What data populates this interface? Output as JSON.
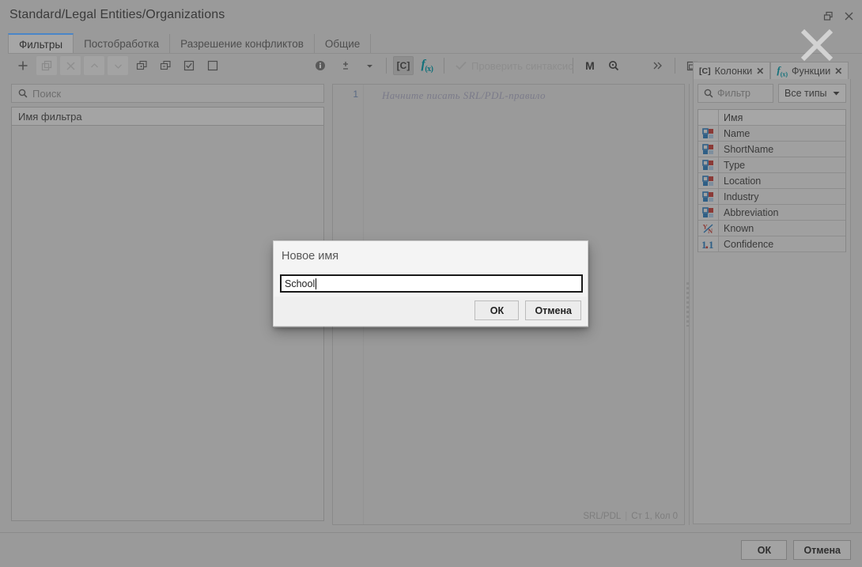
{
  "window": {
    "title": "Standard/Legal Entities/Organizations",
    "restore_icon": "restore-icon",
    "close_icon": "close-icon",
    "overlay_icon": "large-close-x-icon"
  },
  "tabs": [
    {
      "label": "Фильтры",
      "active": true
    },
    {
      "label": "Постобработка",
      "active": false
    },
    {
      "label": "Разрешение конфликтов",
      "active": false
    },
    {
      "label": "Общие",
      "active": false
    }
  ],
  "toolbar_left": [
    {
      "name": "add-filter-button",
      "icon": "plus-icon",
      "state": "enabled"
    },
    {
      "name": "duplicate-filter-button",
      "icon": "duplicate-icon",
      "state": "shaded"
    },
    {
      "name": "delete-filter-button",
      "icon": "close-x-icon",
      "state": "shaded"
    },
    {
      "name": "move-up-button",
      "icon": "chevron-up-icon",
      "state": "shaded"
    },
    {
      "name": "move-down-button",
      "icon": "chevron-down-icon",
      "state": "shaded"
    },
    {
      "name": "expand-all-button",
      "icon": "expand-box-plus-icon",
      "state": "enabled"
    },
    {
      "name": "collapse-all-button",
      "icon": "collapse-box-minus-icon",
      "state": "enabled"
    },
    {
      "name": "check-all-button",
      "icon": "checkbox-checked-icon",
      "state": "enabled"
    },
    {
      "name": "uncheck-all-button",
      "icon": "checkbox-empty-icon",
      "state": "enabled"
    }
  ],
  "toolbar_info": {
    "name": "info-button",
    "icon": "info-circle-icon"
  },
  "toolbar_middle": {
    "font_size_button": {
      "icon": "plus-minus-icon"
    },
    "font_size_dropdown": {
      "icon": "caret-down-icon"
    },
    "columns_toggle": {
      "label": "[C]",
      "icon": "columns-bracket-icon",
      "pressed": true
    },
    "functions_toggle": {
      "label": "f",
      "sub": "(x)",
      "icon": "function-fx-icon"
    },
    "check_syntax": {
      "label": "Проверить синтаксис",
      "icon": "checkmark-icon",
      "disabled": true
    },
    "markdown_button": {
      "label": "M",
      "icon": "markdown-m-icon"
    },
    "find_button": {
      "icon": "magnifier-icon"
    },
    "overflow_button": {
      "icon": "double-chevron-right-icon"
    },
    "panel_button": {
      "icon": "panel-layout-icon"
    }
  },
  "left_panel": {
    "search": {
      "placeholder": "Поиск",
      "value": "",
      "icon": "search-icon"
    },
    "column_header": "Имя фильтра",
    "rows": []
  },
  "editor": {
    "line_number": "1",
    "placeholder": "Начните писать SRL/PDL-правило",
    "status_language": "SRL/PDL",
    "status_separator": "|",
    "status_position": "Ст 1, Кол 0"
  },
  "splitter": {
    "name": "editor-panel-splitter"
  },
  "right_panel": {
    "tabs": [
      {
        "label": "Колонки",
        "icon": "columns-bracket-icon",
        "icon_text": "[C]",
        "close": "✕",
        "active": true
      },
      {
        "label": "Функции",
        "icon": "function-fx-icon",
        "icon_text": "f",
        "icon_sub": "(x)",
        "close": "✕",
        "active": false
      }
    ],
    "filter_input": {
      "placeholder": "Фильтр",
      "value": "",
      "icon": "search-icon"
    },
    "type_select": {
      "value": "Все типы",
      "icon": "caret-down-icon"
    },
    "table_header": "Имя",
    "columns": [
      {
        "name": "Name",
        "type": "string"
      },
      {
        "name": "ShortName",
        "type": "string"
      },
      {
        "name": "Type",
        "type": "string"
      },
      {
        "name": "Location",
        "type": "string"
      },
      {
        "name": "Industry",
        "type": "string"
      },
      {
        "name": "Abbreviation",
        "type": "string"
      },
      {
        "name": "Known",
        "type": "boolean"
      },
      {
        "name": "Confidence",
        "type": "number"
      }
    ]
  },
  "dialog": {
    "title": "Новое имя",
    "input_value": "School",
    "ok_label": "ОК",
    "cancel_label": "Отмена"
  },
  "footer": {
    "ok_label": "ОК",
    "cancel_label": "Отмена"
  },
  "colors": {
    "window_bg": "#9a9a9a",
    "accent_tab": "#4a86c8",
    "fx_teal": "#10707a",
    "icon_blue": "#2f5f86",
    "icon_red": "#8b3a36",
    "dialog_bg": "#f4f4f4"
  }
}
